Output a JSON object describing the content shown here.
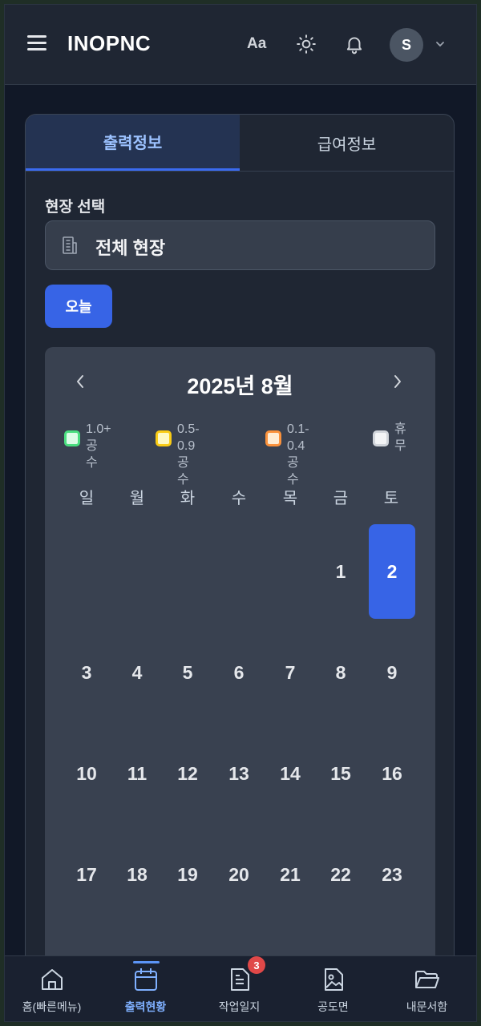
{
  "header": {
    "brand": "INOPNC",
    "font_size_label": "Aa",
    "avatar_initial": "S"
  },
  "tabs": [
    {
      "label": "출력정보",
      "active": true
    },
    {
      "label": "급여정보",
      "active": false
    }
  ],
  "site": {
    "label": "현장 선택",
    "value": "전체 현장"
  },
  "today_label": "오늘",
  "calendar": {
    "title": "2025년 8월",
    "legend": [
      {
        "line1": "1.0+ 공",
        "line2": "수",
        "color": "#4ade80"
      },
      {
        "line1": "0.5-0.9 공",
        "line2": "수",
        "color": "#facc15"
      },
      {
        "line1": "0.1-0.4 공",
        "line2": "수",
        "color": "#fb923c"
      },
      {
        "line1": "휴",
        "line2": "무",
        "color": "#d1d5db"
      }
    ],
    "weekdays": [
      "일",
      "월",
      "화",
      "수",
      "목",
      "금",
      "토"
    ],
    "days": [
      "1",
      "2",
      "3",
      "4",
      "5",
      "6",
      "7",
      "8",
      "9",
      "10",
      "11",
      "12",
      "13",
      "14",
      "15",
      "16",
      "17",
      "18",
      "19",
      "20",
      "21",
      "22",
      "23"
    ],
    "selected_day": "2"
  },
  "bottom_nav": [
    {
      "label": "홈(빠른메뉴)",
      "icon": "home-icon",
      "active": false
    },
    {
      "label": "출력현황",
      "icon": "calendar-icon",
      "active": true
    },
    {
      "label": "작업일지",
      "icon": "document-icon",
      "active": false,
      "badge": "3"
    },
    {
      "label": "공도면",
      "icon": "image-file-icon",
      "active": false
    },
    {
      "label": "내문서함",
      "icon": "folder-icon",
      "active": false
    }
  ],
  "colors": {
    "accent": "#3764e6",
    "background": "#111827",
    "surface": "#1f2633",
    "calendar_bg": "#394150",
    "badge": "#e04848"
  }
}
